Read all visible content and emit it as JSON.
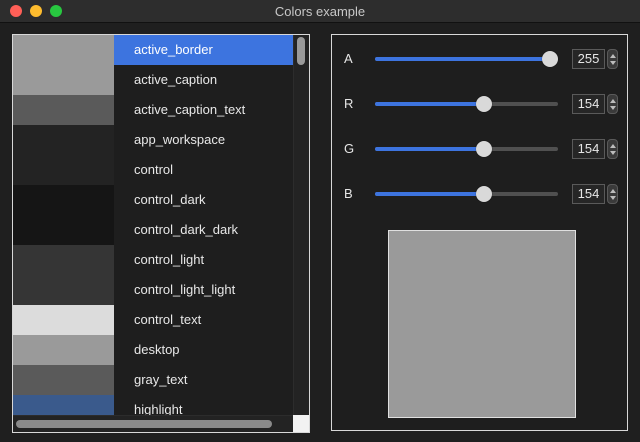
{
  "window": {
    "title": "Colors example"
  },
  "list": {
    "selected_index": 0,
    "items": [
      {
        "label": "active_border",
        "swatch": "#9a9a9a"
      },
      {
        "label": "active_caption",
        "swatch": "#9a9a9a"
      },
      {
        "label": "active_caption_text",
        "swatch": "#5a5a5a"
      },
      {
        "label": "app_workspace",
        "swatch": "#232323"
      },
      {
        "label": "control",
        "swatch": "#232323"
      },
      {
        "label": "control_dark",
        "swatch": "#151515"
      },
      {
        "label": "control_dark_dark",
        "swatch": "#151515"
      },
      {
        "label": "control_light",
        "swatch": "#353535"
      },
      {
        "label": "control_light_light",
        "swatch": "#353535"
      },
      {
        "label": "control_text",
        "swatch": "#dcdcdc"
      },
      {
        "label": "desktop",
        "swatch": "#9a9a9a"
      },
      {
        "label": "gray_text",
        "swatch": "#5a5a5a"
      },
      {
        "label": "highlight",
        "swatch": "#3a5a8c"
      }
    ]
  },
  "color_editor": {
    "channels": [
      {
        "label": "A",
        "value": "255",
        "level": 255
      },
      {
        "label": "R",
        "value": "154",
        "level": 154
      },
      {
        "label": "G",
        "value": "154",
        "level": 154
      },
      {
        "label": "B",
        "value": "154",
        "level": 154
      }
    ],
    "preview_color": "#9a9a9a",
    "accent": "#3d74df"
  }
}
